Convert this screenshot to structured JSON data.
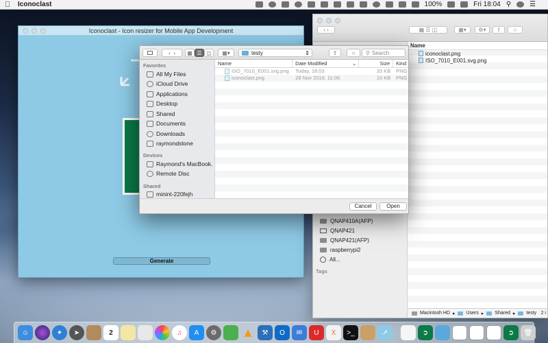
{
  "menubar": {
    "app_name": "Iconoclast",
    "battery": "100%",
    "clock": "Fri 18:04"
  },
  "app_window": {
    "title": "Iconoclast - Icon resizer for Mobile App Development",
    "generate_label": "Generate"
  },
  "dialog": {
    "path_label": "testy",
    "search_placeholder": "Search",
    "sidebar": {
      "favorites_heading": "Favorites",
      "favorites": [
        "All My Files",
        "iCloud Drive",
        "Applications",
        "Desktop",
        "Shared",
        "Documents",
        "Downloads",
        "raymondstone"
      ],
      "devices_heading": "Devices",
      "devices": [
        "Raymond's MacBook...",
        "Remote Disc"
      ],
      "shared_heading": "Shared",
      "shared": [
        "minint-220fejh"
      ]
    },
    "columns": {
      "name": "Name",
      "date_modified": "Date Modified",
      "size": "Size",
      "kind": "Kind"
    },
    "files": [
      {
        "name": "ISO_7010_E001.svg.png",
        "date": "Today, 18:03",
        "size": "33 KB",
        "kind": "PNG"
      },
      {
        "name": "iconoclast.png",
        "date": "28 Nov 2016, 11:06",
        "size": "10 KB",
        "kind": "PNG"
      }
    ],
    "cancel_label": "Cancel",
    "open_label": "Open"
  },
  "finder": {
    "column_name": "Name",
    "files": [
      "iconoclast.png",
      "ISO_7010_E001.svg.png"
    ],
    "shared_items": [
      "QNAP410A(AFP)",
      "QNAP421",
      "QNAP421(AFP)",
      "raspberrypi2",
      "All..."
    ],
    "tags_heading": "Tags",
    "path": [
      "Macintosh HD",
      "Users",
      "Shared",
      "testy"
    ],
    "status_suffix": "2 i"
  },
  "dock": {
    "calendar_day": "2"
  },
  "colors": {
    "app_bg": "#8ecae6",
    "green_card": "#0a7a47",
    "folder_blue": "#6aaedb"
  }
}
